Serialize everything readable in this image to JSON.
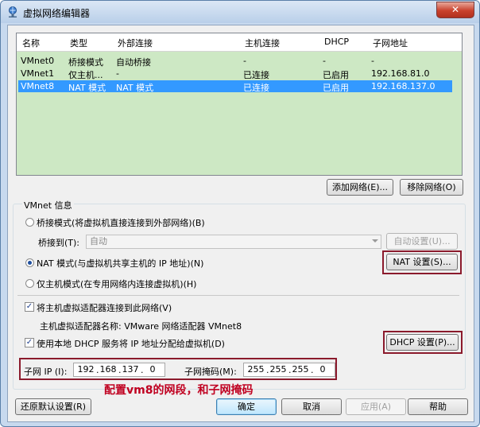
{
  "window": {
    "title": "虚拟网络编辑器",
    "close_icon": "close-icon",
    "app_icon": "network-editor-icon"
  },
  "table": {
    "columns": [
      "名称",
      "类型",
      "外部连接",
      "主机连接",
      "DHCP",
      "子网地址"
    ],
    "rows": [
      {
        "name": "VMnet0",
        "type": "桥接模式",
        "external": "自动桥接",
        "host": "-",
        "dhcp": "-",
        "subnet": "-"
      },
      {
        "name": "VMnet1",
        "type": "仅主机...",
        "external": "-",
        "host": "已连接",
        "dhcp": "已启用",
        "subnet": "192.168.81.0"
      },
      {
        "name": "VMnet8",
        "type": "NAT 模式",
        "external": "NAT 模式",
        "host": "已连接",
        "dhcp": "已启用",
        "subnet": "192.168.137.0"
      }
    ],
    "selected_index": 2,
    "background_color": "#cde8c4",
    "selection_color": "#3399ff"
  },
  "list_buttons": {
    "add_network": "添加网络(E)...",
    "remove_network": "移除网络(O)"
  },
  "vmnet_info": {
    "group_title": "VMnet 信息",
    "bridged_label": "桥接模式(将虚拟机直接连接到外部网络)(B)",
    "bridge_to_label": "桥接到(T):",
    "bridge_to_value": "自动",
    "auto_settings": "自动设置(U)...",
    "nat_label": "NAT 模式(与虚拟机共享主机的 IP 地址)(N)",
    "nat_settings": "NAT 设置(S)...",
    "host_only_label": "仅主机模式(在专用网络内连接虚拟机)(H)",
    "connect_adapter_label": "将主机虚拟适配器连接到此网络(V)",
    "adapter_name_label": "主机虚拟适配器名称: VMware 网络适配器 VMnet8",
    "dhcp_label": "使用本地 DHCP 服务将 IP 地址分配给虚拟机(D)",
    "dhcp_settings": "DHCP 设置(P)...",
    "selected_mode": "nat",
    "connect_adapter_checked": true,
    "dhcp_checked": true
  },
  "subnet": {
    "ip_label": "子网 IP (I):",
    "ip": [
      "192",
      "168",
      "137",
      "0"
    ],
    "mask_label": "子网掩码(M):",
    "mask": [
      "255",
      "255",
      "255",
      "0"
    ]
  },
  "annotation": {
    "text": "配置vm8的网段，和子网掩码",
    "color": "#c00020"
  },
  "footer": {
    "restore_defaults": "还原默认设置(R)",
    "ok": "确定",
    "cancel": "取消",
    "apply": "应用(A)",
    "help": "帮助"
  }
}
